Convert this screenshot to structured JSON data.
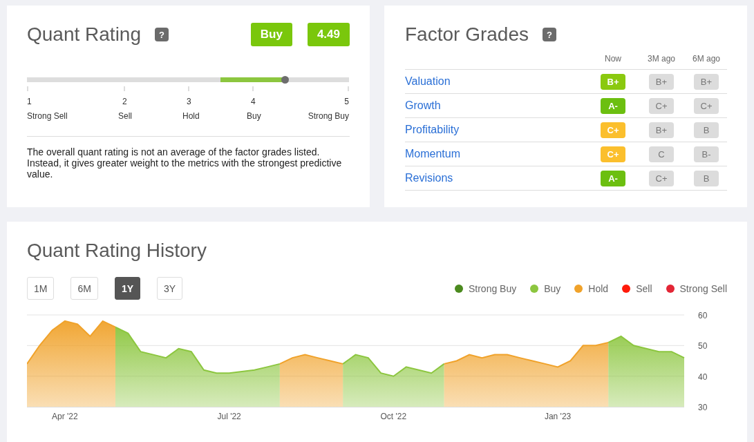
{
  "quant_rating": {
    "title": "Quant Rating",
    "help": "?",
    "rating_label": "Buy",
    "score": "4.49",
    "scale": {
      "level": 0.8,
      "ticks": [
        {
          "number": "1",
          "label": "Strong Sell"
        },
        {
          "number": "2",
          "label": "Sell"
        },
        {
          "number": "3",
          "label": "Hold"
        },
        {
          "number": "4",
          "label": "Buy"
        },
        {
          "number": "5",
          "label": "Strong Buy"
        }
      ]
    },
    "note": "The overall quant rating is not an average of the factor grades listed. Instead, it gives greater weight to the metrics with the strongest predictive value."
  },
  "factor_grades": {
    "title": "Factor Grades",
    "help": "?",
    "columns": [
      "Now",
      "3M ago",
      "6M ago"
    ],
    "rows": [
      {
        "name": "Valuation",
        "now": {
          "grade": "B+",
          "color": "#8ac90f"
        },
        "m3": "B+",
        "m6": "B+"
      },
      {
        "name": "Growth",
        "now": {
          "grade": "A-",
          "color": "#6cbf10"
        },
        "m3": "C+",
        "m6": "C+"
      },
      {
        "name": "Profitability",
        "now": {
          "grade": "C+",
          "color": "#fbbf2d"
        },
        "m3": "B+",
        "m6": "B"
      },
      {
        "name": "Momentum",
        "now": {
          "grade": "C+",
          "color": "#fbbf2d"
        },
        "m3": "C",
        "m6": "B-"
      },
      {
        "name": "Revisions",
        "now": {
          "grade": "A-",
          "color": "#6cbf10"
        },
        "m3": "C+",
        "m6": "B"
      }
    ]
  },
  "history": {
    "title": "Quant Rating History",
    "periods": [
      {
        "label": "1M",
        "selected": false
      },
      {
        "label": "6M",
        "selected": false
      },
      {
        "label": "1Y",
        "selected": true
      },
      {
        "label": "3Y",
        "selected": false
      }
    ],
    "legend": [
      {
        "label": "Strong Buy",
        "color": "#4b8a1e"
      },
      {
        "label": "Buy",
        "color": "#8cc63f"
      },
      {
        "label": "Hold",
        "color": "#f0a22a"
      },
      {
        "label": "Sell",
        "color": "#ff1a0a"
      },
      {
        "label": "Strong Sell",
        "color": "#e32636"
      }
    ],
    "chart_data": {
      "type": "area",
      "categories": [
        null,
        null,
        null,
        "Apr '22",
        null,
        null,
        null,
        null,
        null,
        null,
        null,
        null,
        null,
        null,
        null,
        null,
        "Jul '22",
        null,
        null,
        null,
        null,
        null,
        null,
        null,
        null,
        null,
        null,
        null,
        null,
        "Oct '22",
        null,
        null,
        null,
        null,
        null,
        null,
        null,
        null,
        null,
        null,
        null,
        null,
        "Jan '23",
        null,
        null,
        null,
        null,
        null,
        null,
        null,
        null,
        null,
        null
      ],
      "ylim": [
        30,
        60
      ],
      "yticks": [
        {
          "value": 30,
          "label": "30"
        },
        {
          "value": 40,
          "label": "40"
        },
        {
          "value": 50,
          "label": "50"
        },
        {
          "value": 60,
          "label": "60"
        }
      ],
      "series": [
        {
          "color": "#f0a22a",
          "values": [
            44,
            50,
            55,
            58,
            57,
            53,
            58,
            56,
            null,
            null,
            null,
            null,
            null,
            null,
            null,
            null,
            null,
            null,
            null,
            null,
            44,
            46,
            47,
            46,
            45,
            44,
            null,
            null,
            null,
            null,
            null,
            null,
            null,
            44,
            45,
            47,
            46,
            47,
            47,
            46,
            45,
            44,
            43,
            45,
            50,
            50,
            51,
            null,
            null,
            null,
            null,
            null,
            null
          ]
        },
        {
          "color": "#8cc63f",
          "values": [
            null,
            null,
            null,
            null,
            null,
            null,
            null,
            56,
            54,
            48,
            47,
            46,
            49,
            48,
            42,
            41,
            41,
            41.5,
            42,
            43,
            44,
            null,
            null,
            null,
            null,
            44,
            47,
            46,
            41,
            40,
            43,
            42,
            41,
            44,
            null,
            null,
            null,
            null,
            null,
            null,
            null,
            null,
            null,
            null,
            null,
            null,
            51,
            53,
            50,
            49,
            48,
            48,
            46
          ]
        }
      ]
    }
  }
}
